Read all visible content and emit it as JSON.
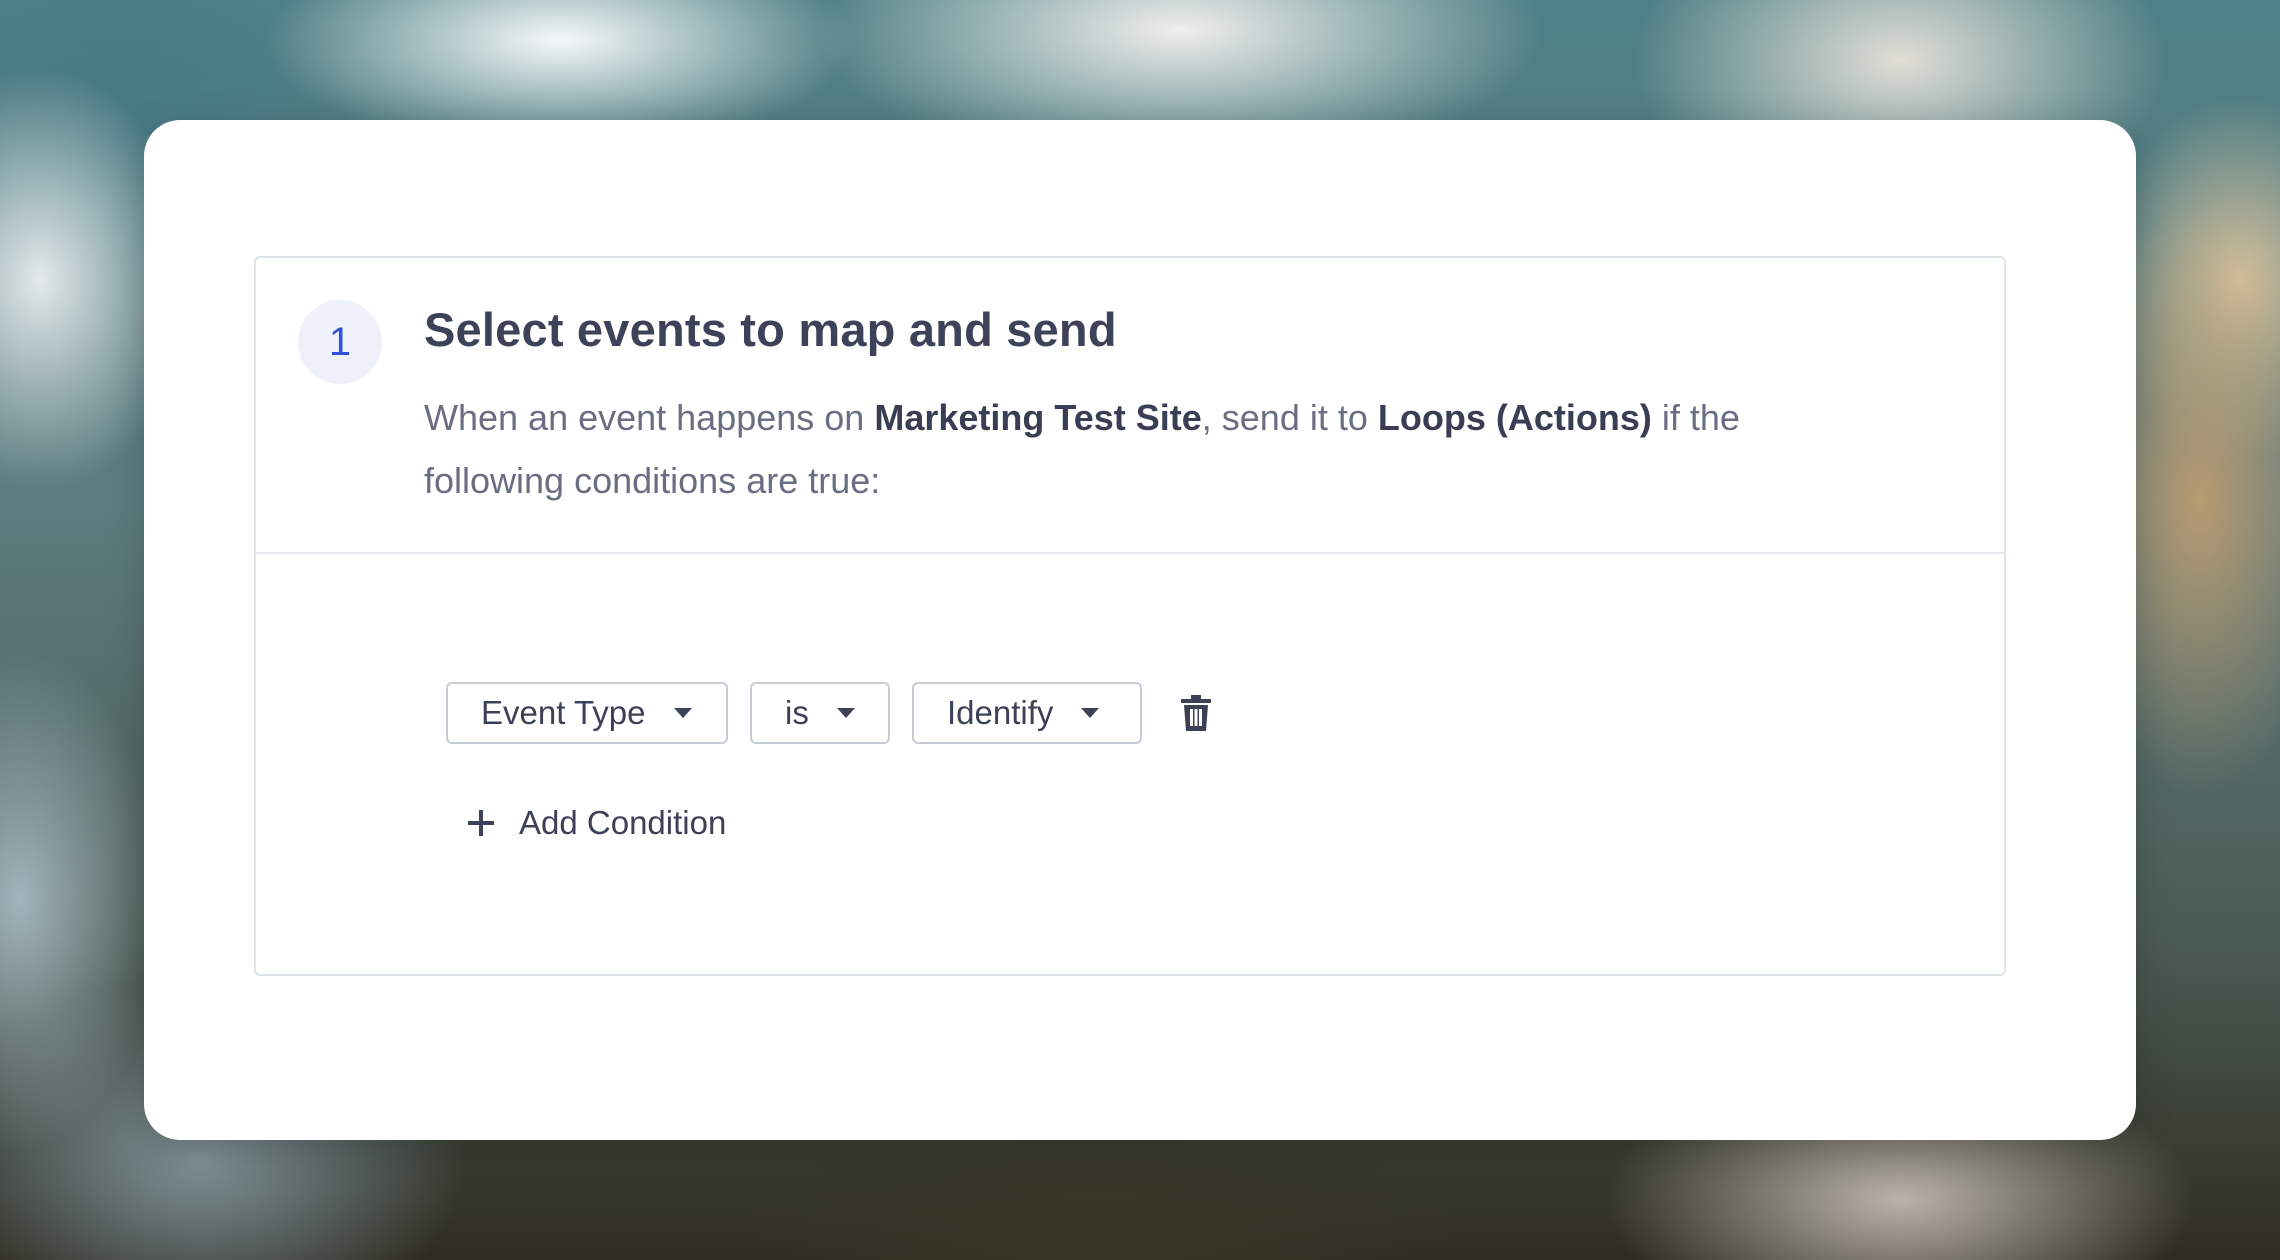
{
  "step": {
    "number": "1",
    "title": "Select events to map and send",
    "description": {
      "prefix": "When an event happens on ",
      "source": "Marketing Test Site",
      "middle": ", send it to ",
      "destination": "Loops (Actions)",
      "suffix": " if the following conditions are true:"
    }
  },
  "condition": {
    "field": "Event Type",
    "operator": "is",
    "value": "Identify",
    "delete_icon": "trash-icon"
  },
  "add_condition": {
    "label": "Add Condition",
    "icon": "plus-icon"
  },
  "colors": {
    "accent": "#2f53d8",
    "text_dark": "#3e4258",
    "text_muted": "#696e82",
    "border": "#c7cbd6"
  }
}
